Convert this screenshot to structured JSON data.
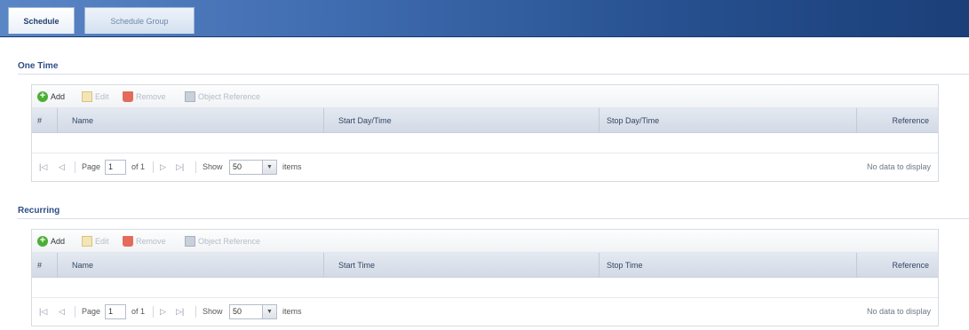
{
  "tabs": [
    {
      "label": "Schedule",
      "active": true
    },
    {
      "label": "Schedule Group",
      "active": false
    }
  ],
  "sections": [
    {
      "title": "One Time",
      "toolbar": {
        "add": "Add",
        "edit": "Edit",
        "remove": "Remove",
        "object_reference": "Object Reference"
      },
      "columns": [
        "#",
        "Name",
        "Start Day/Time",
        "Stop Day/Time",
        "Reference"
      ],
      "pager": {
        "first": "|◁",
        "prev": "◁",
        "page_label": "Page",
        "page_value": "1",
        "of_label": "of 1",
        "next": "▷",
        "last": "▷|",
        "show_label": "Show",
        "show_value": "50",
        "items_label": "items",
        "empty_message": "No data to display"
      }
    },
    {
      "title": "Recurring",
      "toolbar": {
        "add": "Add",
        "edit": "Edit",
        "remove": "Remove",
        "object_reference": "Object Reference"
      },
      "columns": [
        "#",
        "Name",
        "Start Time",
        "Stop Time",
        "Reference"
      ],
      "pager": {
        "first": "|◁",
        "prev": "◁",
        "page_label": "Page",
        "page_value": "1",
        "of_label": "of 1",
        "next": "▷",
        "last": "▷|",
        "show_label": "Show",
        "show_value": "50",
        "items_label": "items",
        "empty_message": "No data to display"
      }
    }
  ],
  "icons": {
    "add": "add-icon",
    "edit": "edit-icon",
    "remove": "trash-icon",
    "object_reference": "object-reference-icon",
    "select_arrow": "chevron-down-icon"
  },
  "colors": {
    "tab_bar": "#26508f",
    "section_title": "#2d4e86",
    "header_bg": "#d3dae6",
    "add_icon": "#4caf35",
    "remove_icon": "#e36b5b"
  }
}
